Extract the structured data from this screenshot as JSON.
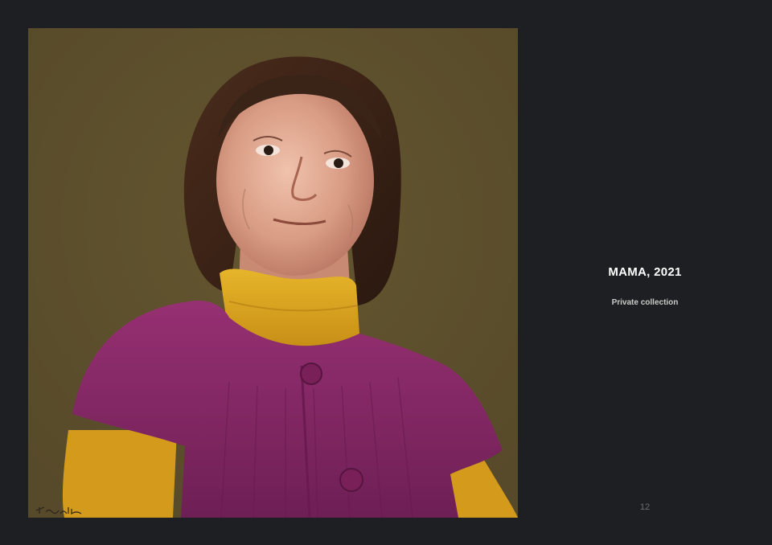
{
  "artwork": {
    "title": "MAMA, 2021",
    "collection": "Private collection",
    "signature": "Tomatt",
    "background_color": "#5f5230",
    "colors": {
      "hair": "#3a2418",
      "skin": "#d9a08a",
      "turtleneck": "#d9a21e",
      "cardigan": "#8a2a6a",
      "sleeves": "#d49a1c"
    }
  },
  "page": {
    "number": "12",
    "background_color": "#1e1f22"
  }
}
